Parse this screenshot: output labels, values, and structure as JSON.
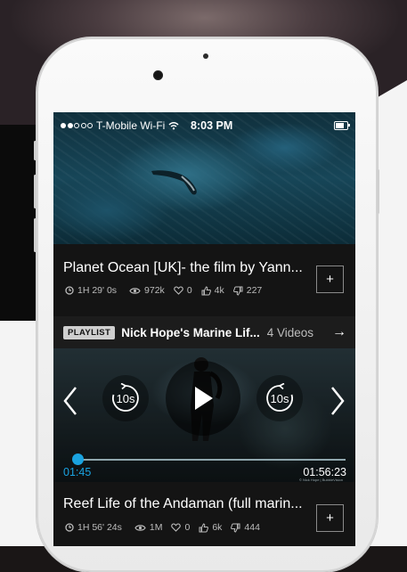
{
  "status_bar": {
    "carrier": "T-Mobile Wi-Fi",
    "time": "8:03 PM",
    "signal_bars_filled": 2,
    "signal_bars_total": 5,
    "battery_level": 0.9
  },
  "card1": {
    "title": "Planet Ocean [UK]- the film by Yann...",
    "duration": "1H 29' 0s",
    "views": "972k",
    "comments": "0",
    "likes": "4k",
    "dislikes": "227",
    "add_label": "+"
  },
  "playlist": {
    "badge": "PLAYLIST",
    "name": "Nick Hope's Marine Lif...",
    "count": "4 Videos",
    "arrow": "→"
  },
  "player": {
    "rewind_label": "10s",
    "forward_label": "10s",
    "elapsed": "01:45",
    "total": "01:56:23",
    "progress": 0.015,
    "credit": "© Nick Hope | BubbleVision"
  },
  "card2": {
    "title": "Reef Life of the Andaman (full marin...",
    "duration": "1H 56' 24s",
    "views": "1M",
    "comments": "0",
    "likes": "6k",
    "dislikes": "444",
    "add_label": "+"
  },
  "colors": {
    "accent": "#1aa3e0",
    "screen_bg": "#141414",
    "playlist_bar": "#1c1c1c"
  }
}
